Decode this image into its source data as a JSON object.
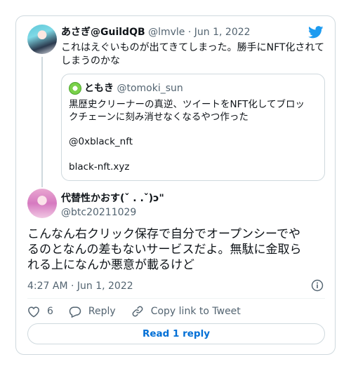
{
  "parent": {
    "display_name": "あさぎ@GuildQB",
    "handle": "@lmvle",
    "separator": " · ",
    "date": "Jun 1, 2022",
    "text_line1": "これはえぐいものが出てきてしまった。勝手にNFT化されて",
    "text_line2": "しまうのかな"
  },
  "quote": {
    "display_name": "ともき",
    "handle": "@tomoki_sun",
    "line1": "黒歴史クリーナーの真逆、ツイートをNFT化してブロッ",
    "line2": "クチェーンに刻み消せなくなるやつ作った",
    "line3": "@0xblack_nft",
    "line4": "black-nft.xyz"
  },
  "reply": {
    "display_name": "代替性かおす(ˇ . .ˇ)ɔ\"",
    "handle": "@btc20211029",
    "text_line1": "こんなん右クリック保存で自分でオープンシーでや",
    "text_line2": "るのとなんの差もないサービスだよ。無駄に金取ら",
    "text_line3": "れる上になんか悪意が載るけど",
    "timestamp": "4:27 AM · Jun 1, 2022"
  },
  "actions": {
    "like_count": "6",
    "reply_label": "Reply",
    "copy_label": "Copy link to Tweet"
  },
  "read_replies_label": "Read 1 reply",
  "icons": {
    "brand": "twitter-bird-icon",
    "info": "info-icon",
    "like": "heart-icon",
    "reply": "speech-bubble-icon",
    "copy": "link-icon"
  },
  "colors": {
    "twitter_blue": "#1d9bf0",
    "link_blue": "#006fd6",
    "secondary_text": "#536471",
    "border": "#cfd9de"
  }
}
